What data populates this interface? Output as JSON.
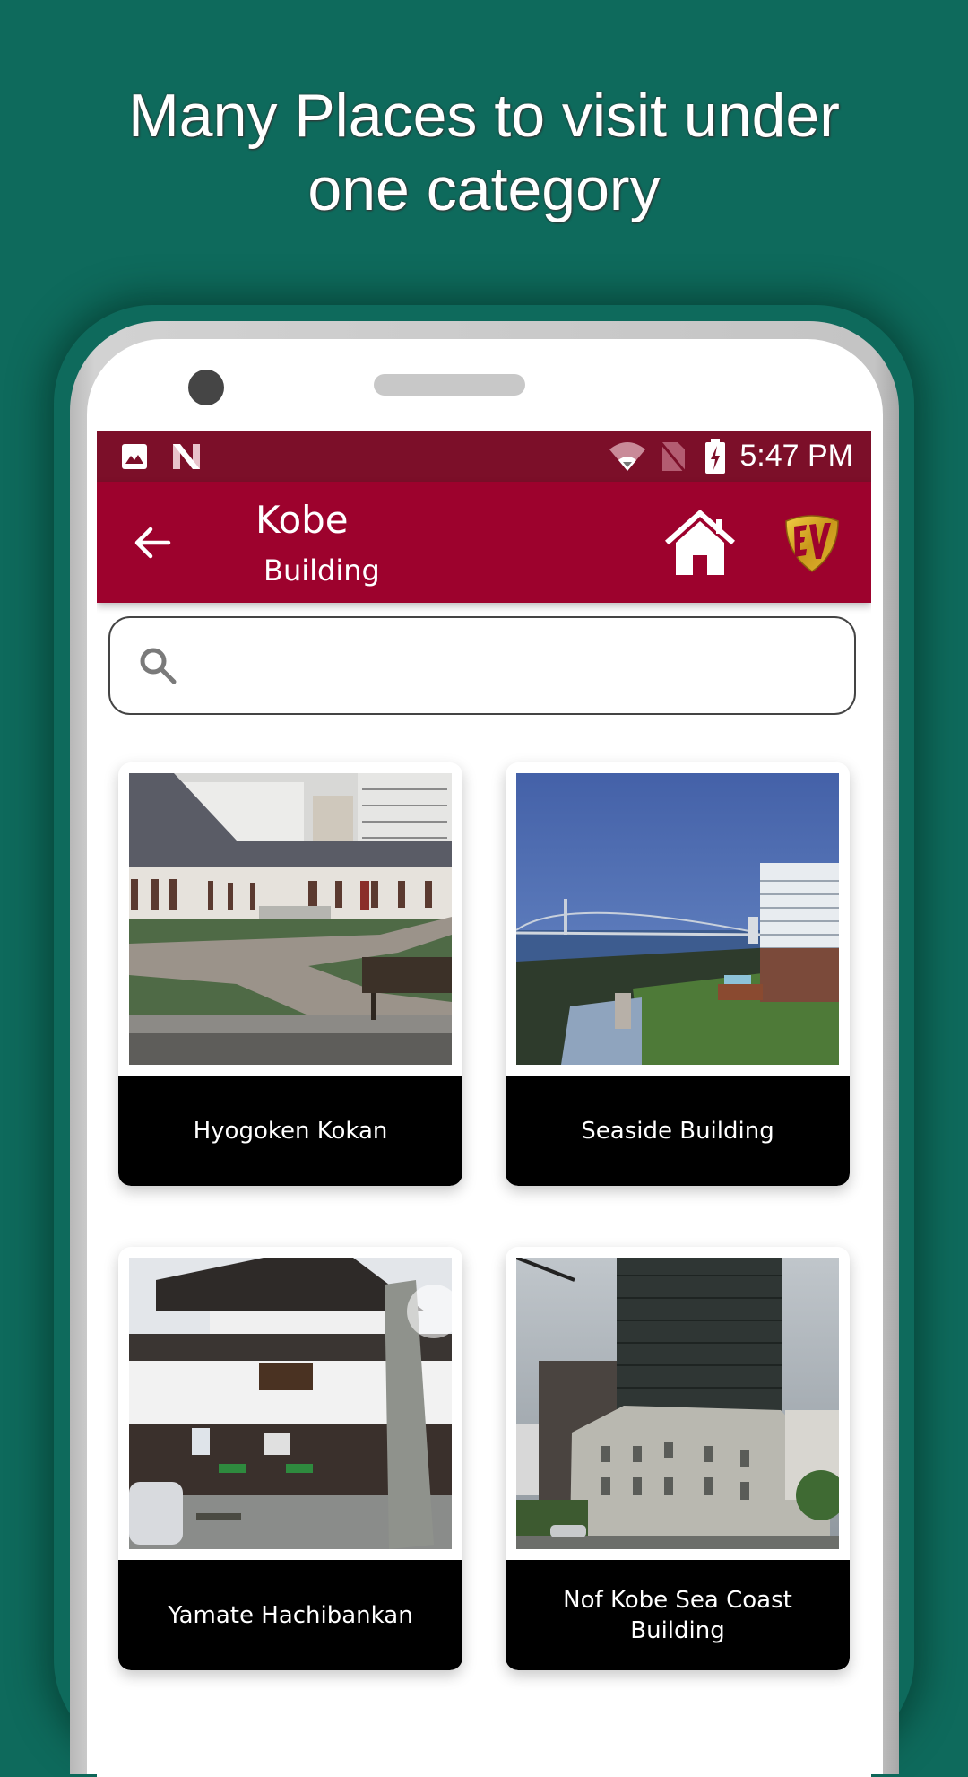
{
  "promo": {
    "headline_line1": "Many Places to visit under",
    "headline_line2": "one category"
  },
  "status_bar": {
    "time": "5:47 PM",
    "left_icons": [
      "image-icon",
      "n-logo-icon"
    ],
    "right_icons": [
      "wifi-icon",
      "no-sim-icon",
      "battery-charging-icon"
    ]
  },
  "app_bar": {
    "title": "Kobe",
    "subtitle": "Building",
    "back_icon": "arrow-left-icon",
    "home_icon": "home-icon",
    "logo_text": "EV"
  },
  "search": {
    "value": "",
    "placeholder": ""
  },
  "places": [
    {
      "name": "Hyogoken Kokan"
    },
    {
      "name": "Seaside Building"
    },
    {
      "name": "Yamate Hachibankan"
    },
    {
      "name": "Nof Kobe Sea Coast Building"
    }
  ],
  "colors": {
    "background": "#0e6a5c",
    "status_bar": "#7c0f29",
    "app_bar": "#9d022d",
    "card_label": "#000000"
  }
}
